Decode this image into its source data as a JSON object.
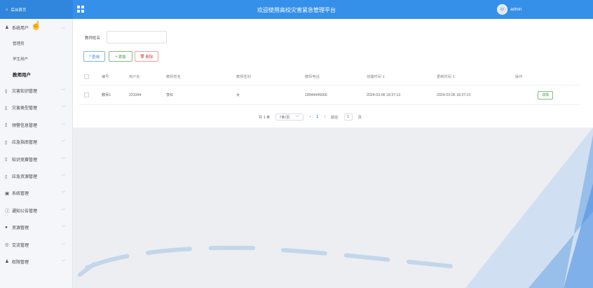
{
  "header": {
    "home_label": "后台首页",
    "title": "欢迎使用高校灾害紧急管理平台",
    "username": "admin"
  },
  "sidebar": {
    "items": [
      {
        "label": "系统用户",
        "icon": "user-icon",
        "expanded": true
      },
      {
        "label": "灾害知识管理",
        "icon": "doc-icon"
      },
      {
        "label": "灾害类型管理",
        "icon": "doc-icon"
      },
      {
        "label": "预警信息管理",
        "icon": "doc-icon"
      },
      {
        "label": "应急指南管理",
        "icon": "doc-icon"
      },
      {
        "label": "知识竞赛管理",
        "icon": "doc-icon"
      },
      {
        "label": "应急资源管理",
        "icon": "doc-icon"
      },
      {
        "label": "系统管理",
        "icon": "settings-icon"
      },
      {
        "label": "通知公告管理",
        "icon": "info-icon"
      },
      {
        "label": "资源管理",
        "icon": "resource-icon"
      },
      {
        "label": "交流管理",
        "icon": "chat-icon"
      },
      {
        "label": "权限管理",
        "icon": "user-icon"
      }
    ],
    "subitems": [
      {
        "label": "管理员"
      },
      {
        "label": "学生用户"
      },
      {
        "label": "教师用户",
        "active": true
      }
    ]
  },
  "search": {
    "label": "教师姓名",
    "value": "",
    "placeholder": ""
  },
  "toolbar": {
    "query_label": "查询",
    "add_label": "添加",
    "delete_label": "删除"
  },
  "table": {
    "headers": [
      "编号",
      "用户名",
      "教师姓名",
      "教师性别",
      "教师电话",
      "创建时间 ⇕",
      "更新时间 ⇕",
      "操作"
    ],
    "rows": [
      {
        "id": "教师1",
        "username": "223344",
        "name": "李红",
        "gender": "女",
        "phone": "18944445666",
        "created": "2024-03-06 18:37:13",
        "updated": "2024-03-06 18:37:13",
        "action": "详情"
      }
    ]
  },
  "pagination": {
    "total_text": "共 1 条",
    "page_size": "7条/页",
    "current_page": "1",
    "goto_prefix": "前往",
    "goto_value": "1",
    "goto_suffix": "页"
  },
  "colors": {
    "topbar": "#3590ea",
    "accent": "#3a86d8",
    "success": "#3b8c3b",
    "danger": "#d84444"
  }
}
